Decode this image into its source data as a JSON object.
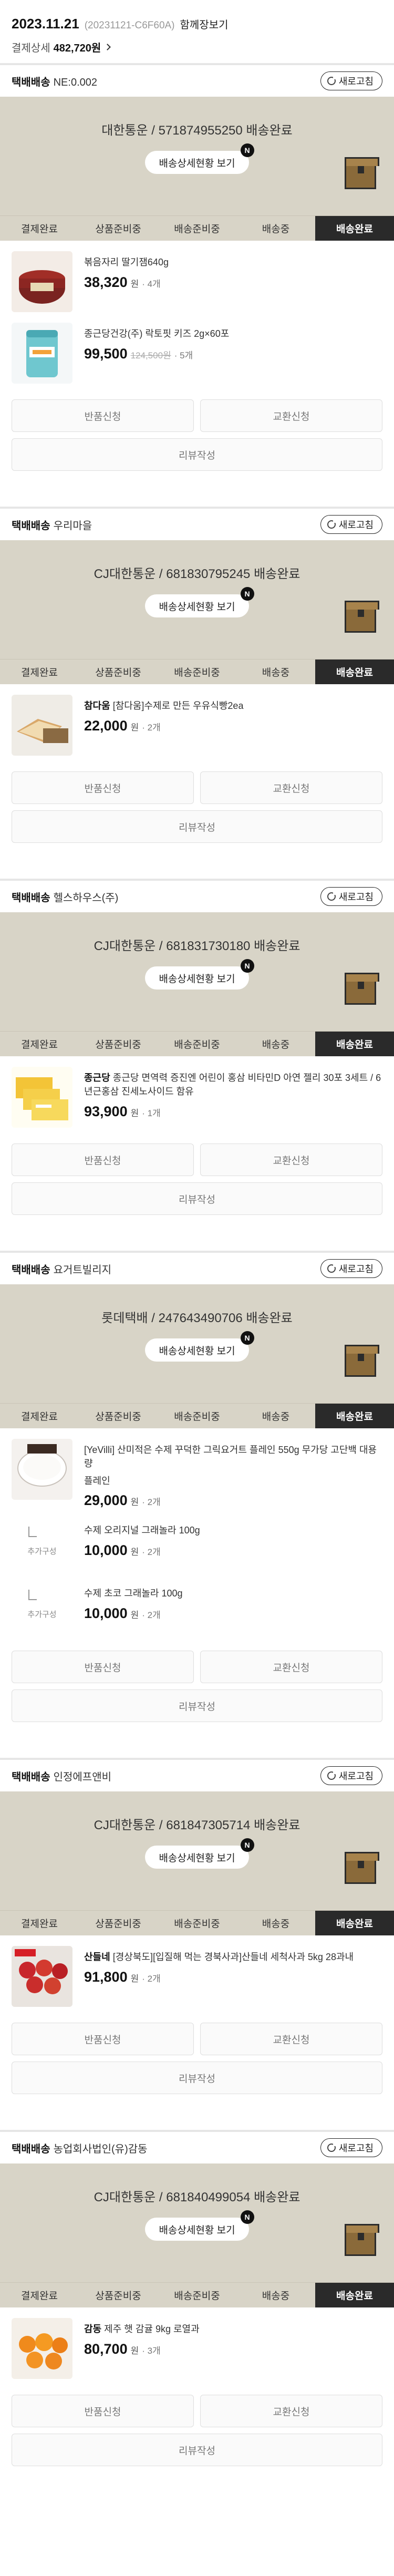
{
  "order": {
    "date": "2023.11.21",
    "code": "(20231121-C6F60A)",
    "view_all": "함께장보기",
    "payment_label": "결제상세",
    "payment_amount": "482,720원"
  },
  "common": {
    "refresh_label": "새로고침",
    "track_label": "배송상세현황 보기",
    "new_badge": "N",
    "steps": [
      "결제완료",
      "상품준비중",
      "배송준비중",
      "배송중",
      "배송완료"
    ],
    "return_label": "반품신청",
    "exchange_label": "교환신청",
    "review_label": "리뷰작성",
    "addon_tag": "추가구성",
    "won": "원",
    "colors": {
      "banner_bg": "#d8d4c7",
      "active_step_bg": "#2a2a2a"
    }
  },
  "shipments": [
    {
      "type_label": "택배배송",
      "seller": "NE:0.002",
      "carrier_line": "대한통운 / 571874955250 배송완료",
      "items": [
        {
          "name": "볶음자리 딸기잼640g",
          "price": "38,320",
          "qty": "· 4개",
          "thumb": "jam-jar"
        },
        {
          "name": "종근당건강(주) 락토핏 키즈 2g×60포",
          "price": "99,500",
          "orig": "124,500원",
          "qty": "· 5개",
          "thumb": "lactofit-can"
        }
      ]
    },
    {
      "type_label": "택배배송",
      "seller": "우리마을",
      "carrier_line": "CJ대한통운 / 681830795245 배송완료",
      "items": [
        {
          "brand": "참다움",
          "name": "[참다움]수제로 만든 우유식빵2ea",
          "price": "22,000",
          "qty": "· 2개",
          "thumb": "bread"
        }
      ]
    },
    {
      "type_label": "택배배송",
      "seller": "헬스하우스(주)",
      "carrier_line": "CJ대한통운 / 681831730180 배송완료",
      "items": [
        {
          "brand": "종근당",
          "name": "종근당 면역력 증진엔 어린이 홍삼 비타민D 아연 젤리 30포 3세트 / 6년근홍삼 진세노사이드 함유",
          "price": "93,900",
          "qty": "· 1개",
          "thumb": "jelly-box"
        }
      ]
    },
    {
      "type_label": "택배배송",
      "seller": "요거트빌리지",
      "carrier_line": "롯데택배 / 247643490706 배송완료",
      "items": [
        {
          "name": "[YeVilli] 산미적은 수제 꾸덕한 그릭요거트 플레인 550g 무가당 고단백 대용량",
          "opt": "플레인",
          "price": "29,000",
          "qty": "· 2개",
          "thumb": "yogurt-bowl"
        }
      ],
      "addons": [
        {
          "name": "수제 오리지널 그래놀라 100g",
          "price": "10,000",
          "qty": "· 2개"
        },
        {
          "name": "수제 초코 그래놀라 100g",
          "price": "10,000",
          "qty": "· 2개"
        }
      ]
    },
    {
      "type_label": "택배배송",
      "seller": "인정에프앤비",
      "carrier_line": "CJ대한통운 / 681847305714 배송완료",
      "items": [
        {
          "brand": "산들네",
          "name": "[경상북도][입질해 먹는 경북사과]산들네 세척사과 5kg 28과내",
          "price": "91,800",
          "qty": "· 2개",
          "thumb": "apples"
        }
      ]
    },
    {
      "type_label": "택배배송",
      "seller": "농업회사법인(유)감동",
      "carrier_line": "CJ대한통운 / 681840499054 배송완료",
      "items": [
        {
          "brand": "감동",
          "name": "제주 햇 감귤 9kg 로열과",
          "price": "80,700",
          "qty": "· 3개",
          "thumb": "tangerines"
        }
      ]
    }
  ]
}
